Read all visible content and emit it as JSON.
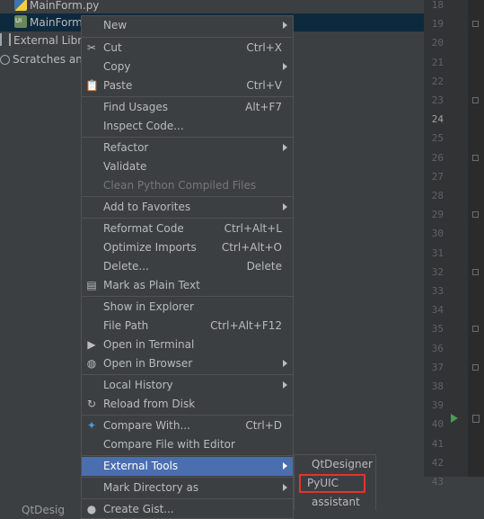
{
  "tree": {
    "items": [
      {
        "label": "MainForm.py"
      },
      {
        "label": "MainForm.ui"
      },
      {
        "label": "External Libra"
      },
      {
        "label": "Scratches and"
      },
      {
        "label": "QtDesig"
      }
    ]
  },
  "gutter": {
    "line_numbers": [
      "18",
      "19",
      "20",
      "21",
      "22",
      "23",
      "24",
      "25",
      "26",
      "27",
      "28",
      "29",
      "30",
      "31",
      "32",
      "33",
      "34",
      "35",
      "36",
      "37",
      "38",
      "39",
      "40",
      "41",
      "42",
      "43"
    ],
    "current_line": "24"
  },
  "menu": {
    "items": [
      {
        "label": "New",
        "shortcut": ""
      },
      {
        "label": "Cut",
        "shortcut": "Ctrl+X"
      },
      {
        "label": "Copy",
        "shortcut": ""
      },
      {
        "label": "Paste",
        "shortcut": "Ctrl+V"
      },
      {
        "label": "Find Usages",
        "shortcut": "Alt+F7"
      },
      {
        "label": "Inspect Code...",
        "shortcut": ""
      },
      {
        "label": "Refactor",
        "shortcut": ""
      },
      {
        "label": "Validate",
        "shortcut": ""
      },
      {
        "label": "Clean Python Compiled Files",
        "shortcut": ""
      },
      {
        "label": "Add to Favorites",
        "shortcut": ""
      },
      {
        "label": "Reformat Code",
        "shortcut": "Ctrl+Alt+L"
      },
      {
        "label": "Optimize Imports",
        "shortcut": "Ctrl+Alt+O"
      },
      {
        "label": "Delete...",
        "shortcut": "Delete"
      },
      {
        "label": "Mark as Plain Text",
        "shortcut": ""
      },
      {
        "label": "Show in Explorer",
        "shortcut": ""
      },
      {
        "label": "File Path",
        "shortcut": "Ctrl+Alt+F12"
      },
      {
        "label": "Open in Terminal",
        "shortcut": ""
      },
      {
        "label": "Open in Browser",
        "shortcut": ""
      },
      {
        "label": "Local History",
        "shortcut": ""
      },
      {
        "label": "Reload from Disk",
        "shortcut": ""
      },
      {
        "label": "Compare With...",
        "shortcut": "Ctrl+D"
      },
      {
        "label": "Compare File with Editor",
        "shortcut": ""
      },
      {
        "label": "External Tools",
        "shortcut": ""
      },
      {
        "label": "Mark Directory as",
        "shortcut": ""
      },
      {
        "label": "Create Gist...",
        "shortcut": ""
      }
    ]
  },
  "submenu": {
    "items": [
      {
        "label": "QtDesigner"
      },
      {
        "label": "PyUIC"
      },
      {
        "label": "assistant"
      }
    ]
  },
  "colors": {
    "background": "#3c3f41",
    "highlight": "#4b6eaf",
    "selected_row": "#0d293e",
    "annotation": "#e0352f",
    "disabled_text": "#777777"
  }
}
